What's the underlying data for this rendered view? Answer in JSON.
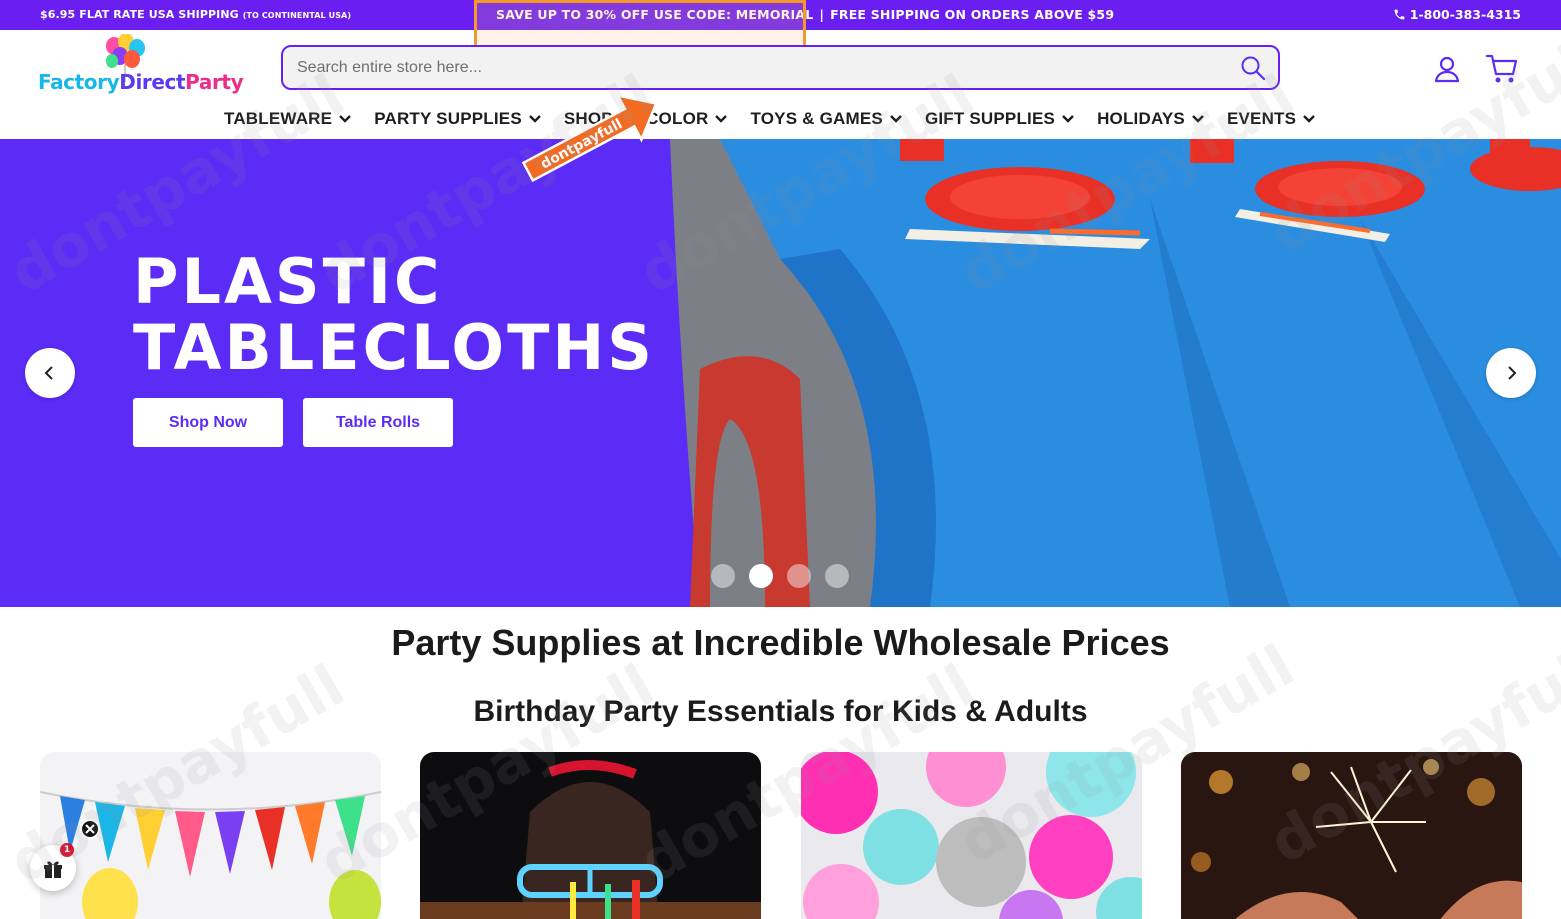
{
  "topbar": {
    "shipping_main": "$6.95 FLAT RATE USA SHIPPING",
    "shipping_note": "(TO CONTINENTAL USA)",
    "promo_code": "SAVE UP TO 30% OFF USE CODE: MEMORIAL",
    "separator": "|",
    "promo_free": "FREE SHIPPING ON ORDERS ABOVE $59",
    "phone": "1-800-383-4315",
    "bg_color": "#6a1ff0"
  },
  "logo": {
    "part1": "Factory",
    "part2": "Direct",
    "part3": "Party"
  },
  "search": {
    "placeholder": "Search entire store here..."
  },
  "badge": {
    "text": "dontpayfull"
  },
  "nav": {
    "items": [
      {
        "label": "TABLEWARE"
      },
      {
        "label": "PARTY SUPPLIES"
      },
      {
        "label": "SHOP BY COLOR"
      },
      {
        "label": "TOYS & GAMES"
      },
      {
        "label": "GIFT SUPPLIES"
      },
      {
        "label": "HOLIDAYS"
      },
      {
        "label": "EVENTS"
      }
    ]
  },
  "hero": {
    "title_line1": "PLASTIC",
    "title_line2": "TABLECLOTHS",
    "button_shop": "Shop Now",
    "button_rolls": "Table Rolls",
    "active_slide": 2,
    "slide_count": 4,
    "bg_color": "#5b2cf5"
  },
  "main": {
    "heading": "Party Supplies at Incredible Wholesale Prices",
    "subheading": "Birthday Party Essentials for Kids & Adults"
  },
  "gift_widget": {
    "count": "1"
  },
  "watermark_text": "dontpayfull"
}
